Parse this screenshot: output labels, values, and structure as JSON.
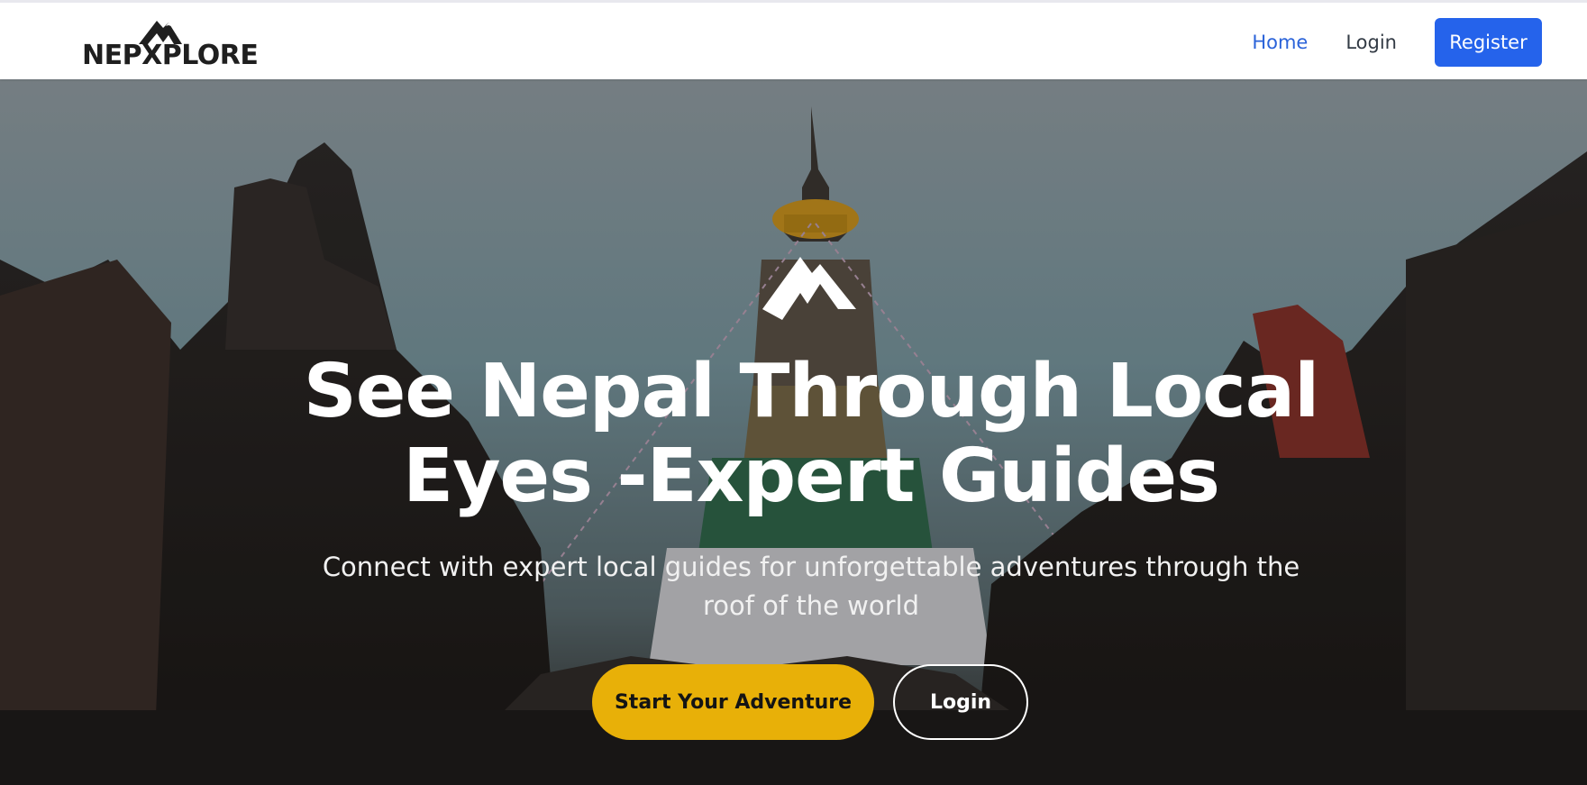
{
  "brand": {
    "name": "NEPXPLORE",
    "logo_icon": "mountain-icon"
  },
  "nav": {
    "items": [
      {
        "label": "Home",
        "active": true
      },
      {
        "label": "Login",
        "active": false
      }
    ],
    "register_label": "Register"
  },
  "hero": {
    "icon": "mountain-icon",
    "title_line1": "See Nepal Through Local",
    "title_line2": "Eyes -Expert Guides",
    "subtitle": "Connect with expert local guides for unforgettable adventures through the roof of the world",
    "primary_button": "Start Your Adventure",
    "secondary_button": "Login"
  },
  "colors": {
    "accent_blue": "#2563eb",
    "nav_active": "#2b63d9",
    "cta_yellow": "#e8b008"
  }
}
